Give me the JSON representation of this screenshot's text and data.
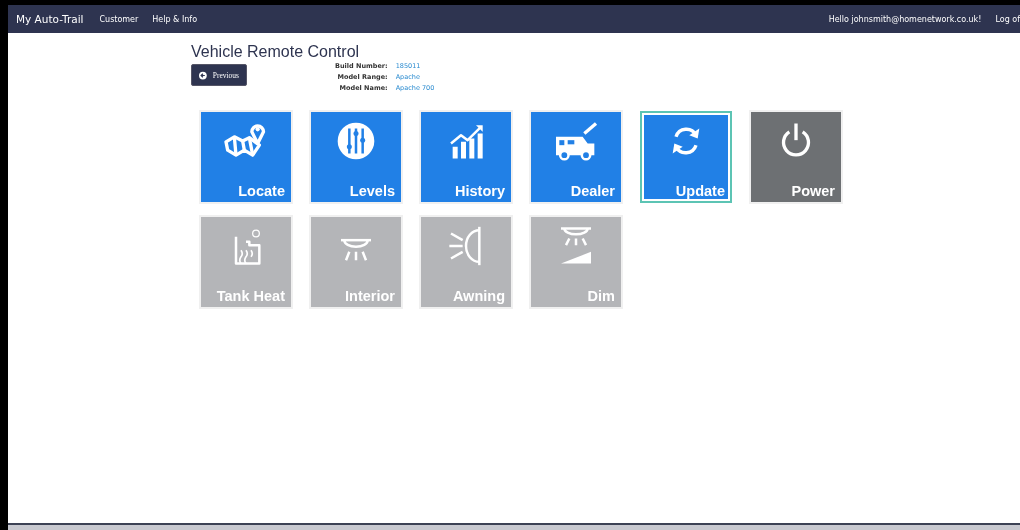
{
  "navbar": {
    "brand": "My Auto-Trail",
    "links": [
      "Customer",
      "Help & Info"
    ],
    "greeting": "Hello johnsmith@homenetwork.co.uk!",
    "logoff": "Log of"
  },
  "page": {
    "title": "Vehicle Remote Control",
    "previous_button": "Previous",
    "details": [
      {
        "label": "Build Number:",
        "value": "185011"
      },
      {
        "label": "Model Range:",
        "value": "Apache"
      },
      {
        "label": "Model Name:",
        "value": "Apache 700"
      }
    ]
  },
  "tiles": [
    {
      "label": "Locate",
      "kind": "map",
      "on": true,
      "disabled": false,
      "selected": false
    },
    {
      "label": "Levels",
      "kind": "levels",
      "on": true,
      "disabled": false,
      "selected": false
    },
    {
      "label": "History",
      "kind": "chart",
      "on": true,
      "disabled": false,
      "selected": false
    },
    {
      "label": "Dealer",
      "kind": "van",
      "on": true,
      "disabled": false,
      "selected": false
    },
    {
      "label": "Update",
      "kind": "refresh",
      "on": true,
      "disabled": false,
      "selected": true
    },
    {
      "label": "Power",
      "kind": "power",
      "on": false,
      "disabled": false,
      "selected": false
    },
    {
      "label": "Tank Heat",
      "kind": "tank",
      "on": false,
      "disabled": true,
      "selected": false
    },
    {
      "label": "Interior",
      "kind": "lamp",
      "on": false,
      "disabled": true,
      "selected": false
    },
    {
      "label": "Awning",
      "kind": "awning",
      "on": false,
      "disabled": true,
      "selected": false
    },
    {
      "label": "Dim",
      "kind": "dim",
      "on": false,
      "disabled": true,
      "selected": false
    }
  ]
}
